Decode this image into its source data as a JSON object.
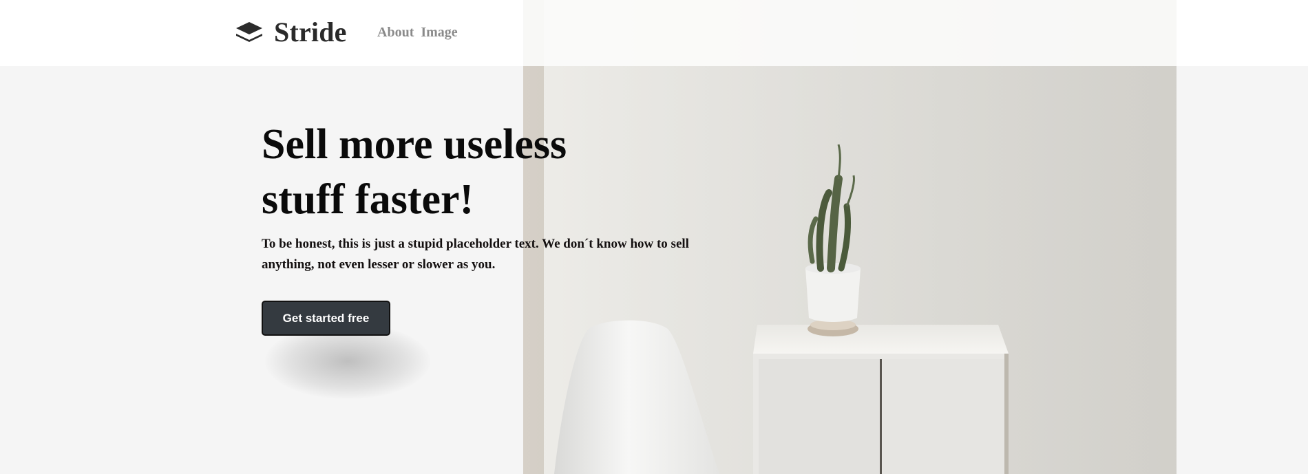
{
  "header": {
    "brand_name": "Stride",
    "brand_icon": "layers-icon",
    "nav": [
      {
        "label": "About"
      },
      {
        "label": "Image"
      }
    ]
  },
  "hero": {
    "title_line1": "Sell more useless",
    "title_line2": "stuff faster!",
    "subtitle": "To be honest, this is just a stupid placeholder text. We don´t know how to sell anything, not even lesser or slower as you.",
    "cta_label": "Get started free",
    "image": {
      "subject": "white chair, white cabinet and potted cactus",
      "icon": "photo-icon"
    }
  },
  "colors": {
    "background": "#f5f5f5",
    "cta_background": "#343a40",
    "title_text": "#0a0a0a",
    "nav_text": "#8a8a8a"
  }
}
